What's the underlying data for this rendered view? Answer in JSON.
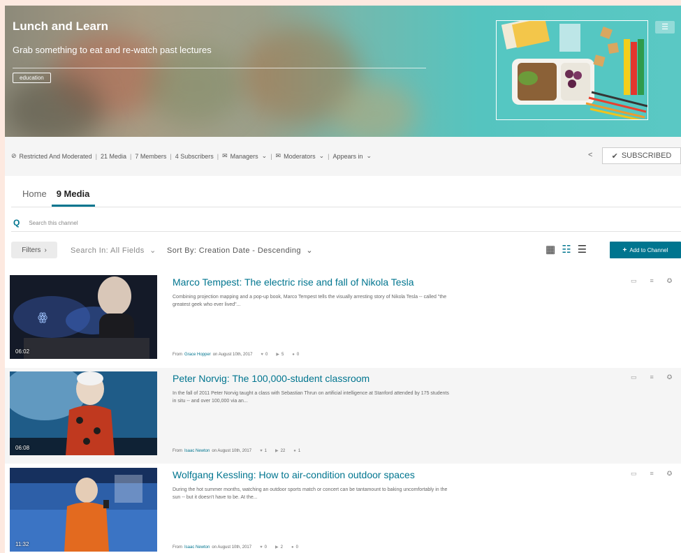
{
  "channel": {
    "title": "Lunch and Learn",
    "subtitle": "Grab something to eat and re-watch past lectures",
    "tag": "education",
    "menu_icon": "list-icon"
  },
  "info": {
    "restricted": "Restricted And Moderated",
    "media": "21 Media",
    "members": "7 Members",
    "subscribers": "4 Subscribers",
    "managers": "Managers",
    "moderators": "Moderators",
    "appears_in": "Appears in",
    "subscribe_label": "SUBSCRIBED"
  },
  "tabs": {
    "home": "Home",
    "media": "9 Media"
  },
  "search": {
    "placeholder": "Search this channel"
  },
  "toolbar": {
    "filters": "Filters",
    "search_in": "Search In: All Fields",
    "sort_by": "Sort By: Creation Date - Descending",
    "add_to_channel": "Add to Channel"
  },
  "entries": [
    {
      "title": "Marco Tempest: The electric rise and fall of Nikola Tesla",
      "description": "Combining projection mapping and a pop-up book, Marco Tempest tells the visually arresting story of Nikola Tesla -- called \"the greatest geek who ever lived\"...",
      "duration": "06:02",
      "from_prefix": "From",
      "author": "Grace Hopper",
      "date": "on August 10th, 2017",
      "likes": "0",
      "plays": "5",
      "comments": "0"
    },
    {
      "title": "Peter Norvig: The 100,000-student classroom",
      "description": "In the fall of 2011 Peter Norvig taught a class with Sebastian Thrun on artificial intelligence at Stanford attended by 175 students in situ -- and over 100,000 via an...",
      "duration": "06:08",
      "from_prefix": "From",
      "author": "Isaac Newton",
      "date": "on August 10th, 2017",
      "likes": "1",
      "plays": "22",
      "comments": "1"
    },
    {
      "title": "Wolfgang Kessling: How to air-condition outdoor spaces",
      "description": "During the hot summer months, watching an outdoor sports match or concert can be tantamount to baking uncomfortably in the sun -- but it doesn't have to be. At the...",
      "duration": "11:32",
      "from_prefix": "From",
      "author": "Isaac Newton",
      "date": "on August 10th, 2017",
      "likes": "0",
      "plays": "2",
      "comments": "0"
    }
  ],
  "colors": {
    "accent": "#00758f",
    "background": "#fde9e0"
  }
}
